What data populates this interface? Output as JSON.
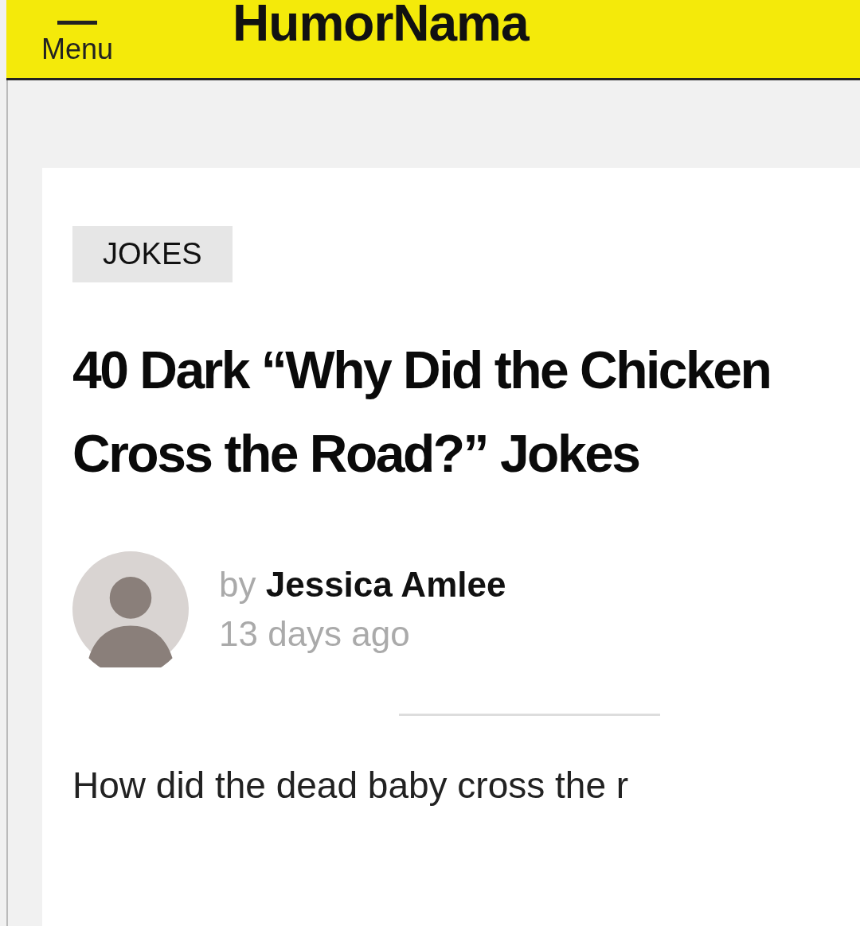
{
  "header": {
    "menu_label": "Menu",
    "logo": "HumorNama"
  },
  "article": {
    "category": "JOKES",
    "title": "40 Dark “Why Did the Chicken Cross the Road?” Jokes",
    "author_prefix": "by",
    "author": "Jessica Amlee",
    "date": "13 days ago",
    "body_start": "How did the dead baby cross the r"
  }
}
